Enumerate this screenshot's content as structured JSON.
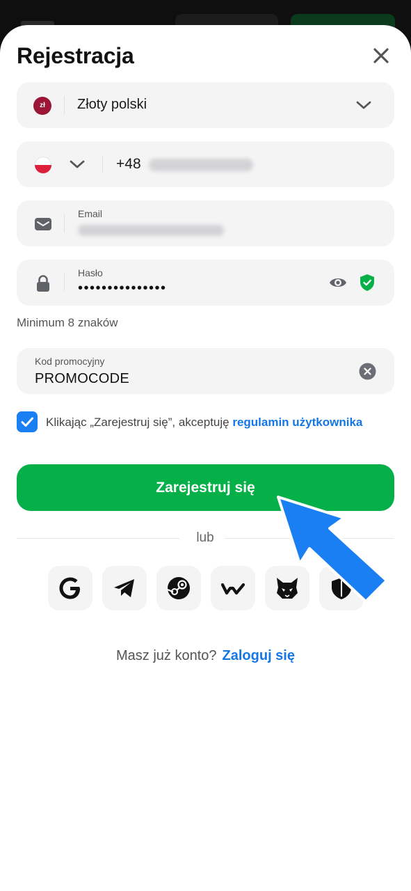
{
  "sheet": {
    "title": "Rejestracja"
  },
  "currency": {
    "badge": "zł",
    "label": "Złoty polski"
  },
  "phone": {
    "code": "+48"
  },
  "email": {
    "label": "Email"
  },
  "password": {
    "label": "Hasło",
    "value_masked": "•••••••••••••••",
    "hint": "Minimum 8 znaków"
  },
  "promo": {
    "label": "Kod promocyjny",
    "value": "PROMOCODE"
  },
  "terms": {
    "checked": true,
    "text": "Klikając „Zarejestruj się”, akceptuję ",
    "link": "regulamin użytkownika"
  },
  "cta": {
    "label": "Zarejestruj się"
  },
  "divider": {
    "label": "lub"
  },
  "social": [
    "google-icon",
    "telegram-icon",
    "steam-icon",
    "walletconnect-icon",
    "metamask-icon",
    "shield-wallet-icon"
  ],
  "login": {
    "question": "Masz już konto?",
    "link": "Zaloguj się"
  },
  "colors": {
    "accent_green": "#06b048",
    "link_blue": "#1577e6",
    "checkbox_blue": "#1a7ff2",
    "field_bg": "#f4f4f5",
    "currency_badge": "#9c1638",
    "annotation_arrow": "#1a7ff2"
  }
}
